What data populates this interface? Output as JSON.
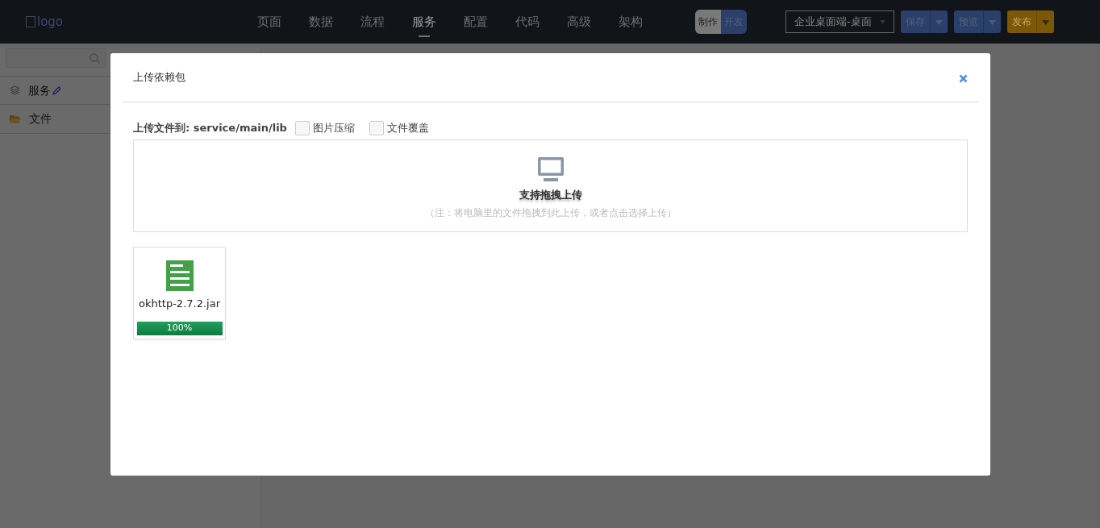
{
  "navbar": {
    "logo": "logo",
    "menu": [
      {
        "label": "页面",
        "selected": false
      },
      {
        "label": "数据",
        "selected": false
      },
      {
        "label": "流程",
        "selected": false
      },
      {
        "label": "服务",
        "selected": true
      },
      {
        "label": "配置",
        "selected": false
      },
      {
        "label": "代码",
        "selected": false
      },
      {
        "label": "高级",
        "selected": false
      },
      {
        "label": "架构",
        "selected": false
      }
    ],
    "mode_toggle": [
      {
        "label": "制作",
        "selected": true
      },
      {
        "label": "开发",
        "selected": false
      }
    ],
    "target_select": "企业桌面端-桌面",
    "actions": [
      {
        "label": "保存",
        "kind": "primary"
      },
      {
        "label": "预览",
        "kind": "primary"
      },
      {
        "label": "发布",
        "kind": "warning"
      }
    ]
  },
  "sidebar": {
    "items": [
      {
        "label": "服务",
        "kind": "service",
        "editable": true
      },
      {
        "label": "文件",
        "kind": "folder",
        "editable": false
      }
    ]
  },
  "dialog": {
    "title": "上传依赖包",
    "path_label": "上传文件到: service/main/lib",
    "options": [
      {
        "label": "图片压缩",
        "checked": false
      },
      {
        "label": "文件覆盖",
        "checked": false
      }
    ],
    "dropzone": {
      "title": "支持拖拽上传",
      "hint": "（注：将电脑里的文件拖拽到此上传，或者点击选择上传）"
    },
    "files": [
      {
        "name": "okhttp-2.7.2.jar",
        "level": 1,
        "reading": "100%"
      }
    ]
  }
}
